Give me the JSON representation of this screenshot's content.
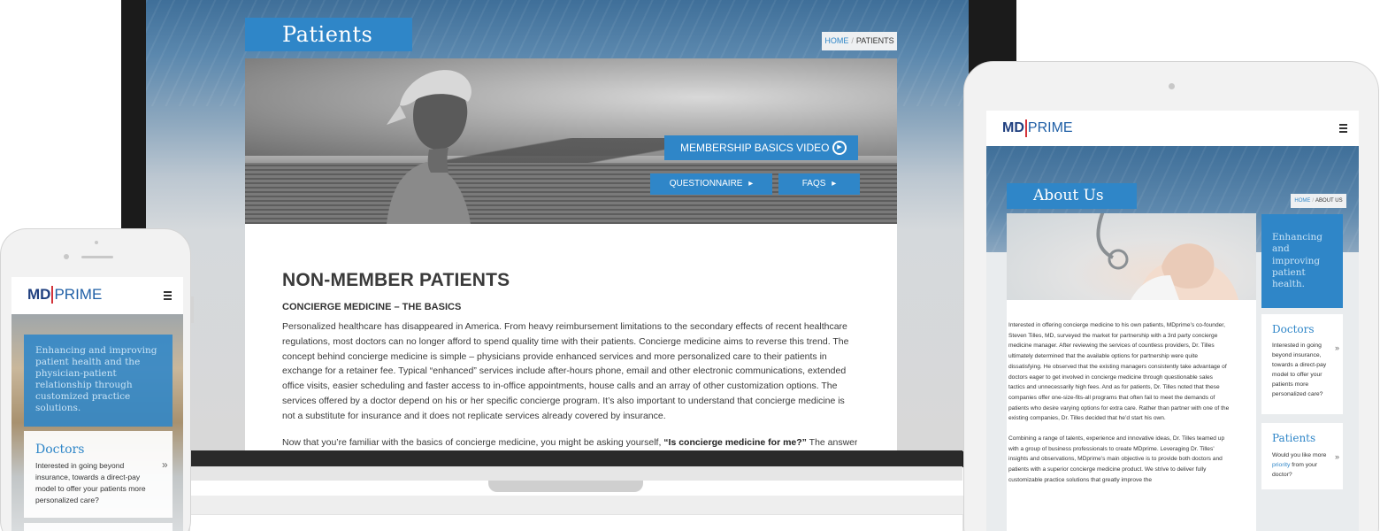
{
  "laptop": {
    "page_title": "Patients",
    "breadcrumb": {
      "home": "HOME",
      "separator": "/",
      "current": "PATIENTS"
    },
    "hero_buttons": {
      "video": "MEMBERSHIP BASICS VIDEO",
      "questionnaire": "QUESTIONNAIRE",
      "faqs": "FAQS",
      "arrow": "▸",
      "play": "▶"
    },
    "heading": "NON-MEMBER PATIENTS",
    "subheading": "CONCIERGE MEDICINE – THE BASICS",
    "paragraph": "Personalized healthcare has disappeared in America. From heavy reimbursement limitations to the secondary effects of recent healthcare regulations, most doctors can no longer afford to spend quality time with their patients. Concierge medicine aims to reverse this trend. The concept behind concierge medicine is simple – physicians provide enhanced services and more personalized care to their patients in exchange for a retainer fee. Typical “enhanced” services include after-hours phone, email and other electronic communications, extended office visits, easier scheduling and faster access to in-office appointments, house calls and an array of other customization options. The services offered by a doctor depend on his or her specific concierge program. It’s also important to understand that concierge medicine is not a substitute for insurance and it does not replicate services already covered by insurance.",
    "paragraph2_start": "Now that you’re familiar with the basics of concierge medicine, you might be asking yourself, ",
    "paragraph2_bold": "“Is concierge medicine for me?”",
    "paragraph2_end": " The answer to this"
  },
  "logo": {
    "md": "MD",
    "prime": "PRIME"
  },
  "phone": {
    "banner_text": "Enhancing and improving patient health and the physician-patient relationship through customized practice solutions.",
    "card": {
      "title": "Doctors",
      "text": "Interested in going beyond insurance, towards a direct-pay model to offer your patients more personalized care?",
      "arrow": "»"
    }
  },
  "tablet": {
    "page_title": "About Us",
    "breadcrumb": {
      "home": "HOME",
      "separator": "/",
      "current": "ABOUT US"
    },
    "body_p1": "Interested in offering concierge medicine to his own patients, MDprime’s co-founder, Steven Tilles, MD, surveyed the market for partnership with a 3rd party concierge medicine manager. After reviewing the services of countless providers, Dr. Tilles ultimately determined that the available options for partnership were quite dissatisfying. He observed that the existing managers consistently take advantage of doctors eager to get involved in concierge medicine through questionable sales tactics and unnecessarily high fees. And as for patients, Dr. Tilles noted that these companies offer one-size-fits-all programs that often fail to meet the demands of patients who desire varying options for extra care. Rather than partner with one of the existing companies, Dr. Tilles decided that he’d start his own.",
    "body_p2": "Combining a range of talents, experience and innovative ideas, Dr. Tilles teamed up with a group of business professionals to create MDprime. Leveraging Dr. Tilles’ insights and observations, MDprime’s main objective is to provide both doctors and patients with a superior concierge medicine product. We strive to deliver fully customizable practice solutions that greatly improve the",
    "side_banner": "Enhancing and improving patient health.",
    "card_doctors": {
      "title": "Doctors",
      "text": "Interested in going beyond insurance, towards a direct-pay model to offer your patients more personalized care?",
      "arrow": "»"
    },
    "card_patients": {
      "title": "Patients",
      "text_before": "Would you like more ",
      "text_highlight": "priority",
      "text_after": " from your doctor?",
      "arrow": "»"
    }
  },
  "colors": {
    "accent": "#2f86c8",
    "logo_dark": "#1f3f7f",
    "logo_red": "#d3333a"
  }
}
